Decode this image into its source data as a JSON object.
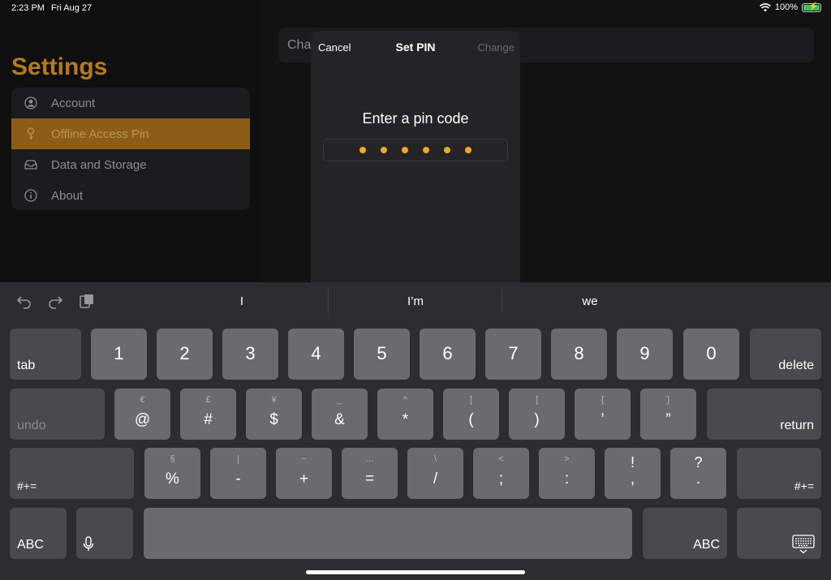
{
  "status_bar": {
    "time": "2:23 PM",
    "date": "Fri Aug 27",
    "battery": "100%",
    "battery_level": 1.0
  },
  "sidebar": {
    "title": "Settings",
    "items": [
      {
        "label": "Account",
        "icon": "person-circle-icon"
      },
      {
        "label": "Offline Access Pin",
        "icon": "key-icon",
        "selected": true
      },
      {
        "label": "Data and Storage",
        "icon": "tray-icon"
      },
      {
        "label": "About",
        "icon": "info-circle-icon"
      }
    ]
  },
  "detail": {
    "field_text": "Char"
  },
  "modal": {
    "cancel_label": "Cancel",
    "title": "Set PIN",
    "change_label": "Change",
    "prompt": "Enter a pin code",
    "pin_length": 6
  },
  "keyboard": {
    "predictions": [
      "I",
      "I’m",
      "we"
    ],
    "row1": {
      "tab": "tab",
      "keys": [
        "1",
        "2",
        "3",
        "4",
        "5",
        "6",
        "7",
        "8",
        "9",
        "0"
      ],
      "delete": "delete"
    },
    "row2": {
      "undo": "undo",
      "keys": [
        {
          "alt": "€",
          "main": "@"
        },
        {
          "alt": "£",
          "main": "#"
        },
        {
          "alt": "¥",
          "main": "$"
        },
        {
          "alt": "_",
          "main": "&"
        },
        {
          "alt": "^",
          "main": "*"
        },
        {
          "alt": "[",
          "main": "("
        },
        {
          "alt": "]",
          "main": ")"
        },
        {
          "alt": "{",
          "main": "’"
        },
        {
          "alt": "}",
          "main": "”"
        }
      ],
      "return": "return"
    },
    "row3": {
      "left": "#+=",
      "keys": [
        {
          "alt": "§",
          "main": "%"
        },
        {
          "alt": "|",
          "main": "-"
        },
        {
          "alt": "~",
          "main": "+"
        },
        {
          "alt": "…",
          "main": "="
        },
        {
          "alt": "\\",
          "main": "/"
        },
        {
          "alt": "<",
          "main": ";"
        },
        {
          "alt": ">",
          "main": ":"
        },
        {
          "alt": "!",
          "main": ","
        },
        {
          "alt": "?",
          "main": "."
        }
      ],
      "right": "#+="
    },
    "row4": {
      "abc_left": "ABC",
      "abc_right": "ABC"
    }
  }
}
